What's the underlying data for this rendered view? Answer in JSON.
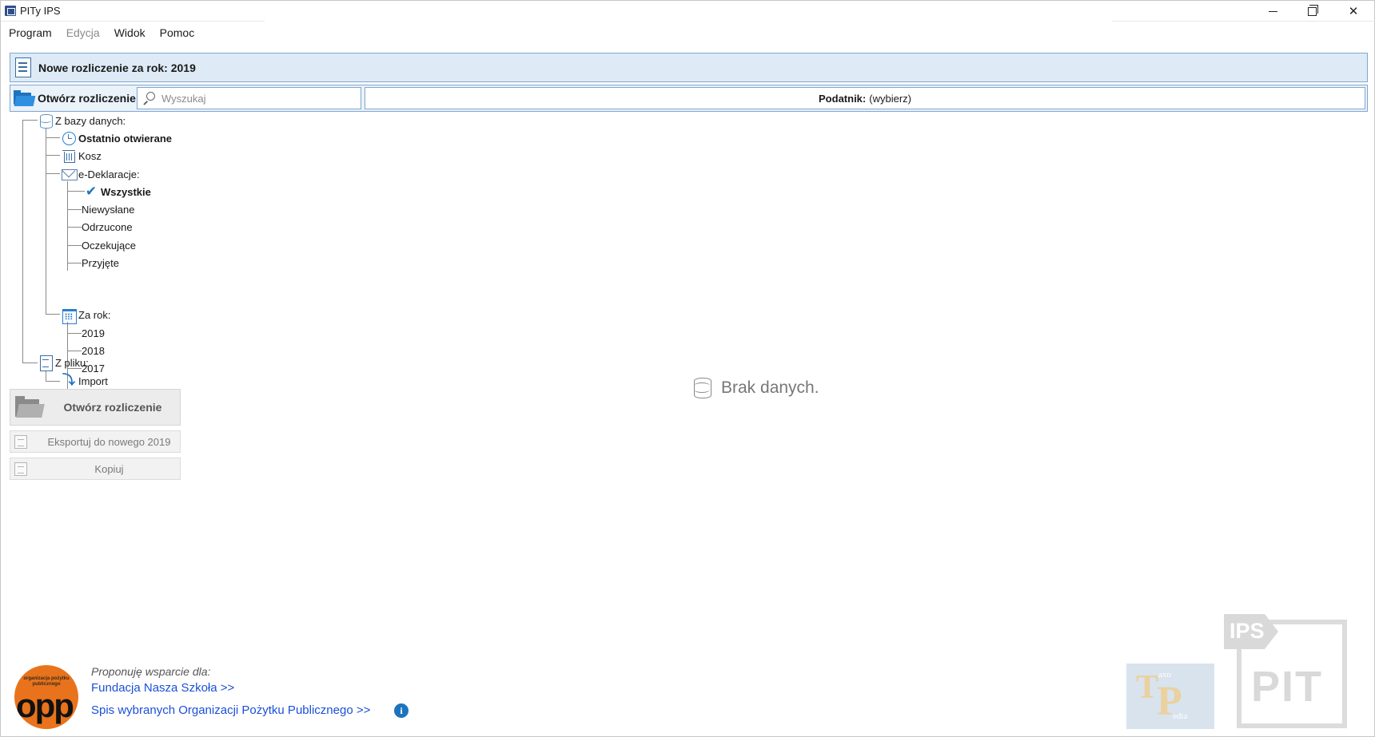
{
  "window": {
    "title": "PITy IPS",
    "controls": {
      "minimize": "minimize-icon",
      "maximize": "restore-icon",
      "close": "close-icon"
    }
  },
  "menu": {
    "items": [
      {
        "label": "Program",
        "enabled": true
      },
      {
        "label": "Edycja",
        "enabled": false
      },
      {
        "label": "Widok",
        "enabled": true
      },
      {
        "label": "Pomoc",
        "enabled": true
      }
    ]
  },
  "new_settlement": {
    "label": "Nowe rozliczenie za rok: 2019"
  },
  "open_row": {
    "open_label": "Otwórz rozliczenie",
    "search_placeholder": "Wyszukaj",
    "search_value": "",
    "taxpayer_label": "Podatnik:",
    "taxpayer_value": "(wybierz)"
  },
  "tree": {
    "database": "Z bazy danych:",
    "recent": "Ostatnio otwierane",
    "trash": "Kosz",
    "edeclarations": "e-Deklaracje:",
    "all": "Wszystkie",
    "unsent": "Niewysłane",
    "rejected": "Odrzucone",
    "pending": "Oczekujące",
    "accepted": "Przyjęte",
    "by_year": "Za rok:",
    "year_2019": "2019",
    "year_2018": "2018",
    "year_2017": "2017",
    "from_file": "Z pliku:",
    "import": "Import"
  },
  "actions": {
    "open": "Otwórz rozliczenie",
    "export": "Eksportuj do nowego 2019",
    "copy": "Kopiuj"
  },
  "main": {
    "empty_text": "Brak danych."
  },
  "footer": {
    "opp_small": "organizacja pożytku publicznego",
    "opp_text": "opp",
    "support_label": "Proponuję wsparcie dla:",
    "link1": "Fundacja Nasza Szkoła >>",
    "link2": "Spis wybranych Organizacji Pożytku Publicznego >>",
    "info": "i",
    "taxo_T": "T",
    "taxo_P": "P",
    "taxo_a": "axo",
    "taxo_b": "edia",
    "ips_flag": "IPS",
    "ips_pit": "PIT"
  },
  "colors": {
    "accent": "#1e73be",
    "header_bg": "#deebf7",
    "border": "#7fa7cf",
    "link": "#1a4fd8",
    "opp_orange": "#e8731c"
  }
}
